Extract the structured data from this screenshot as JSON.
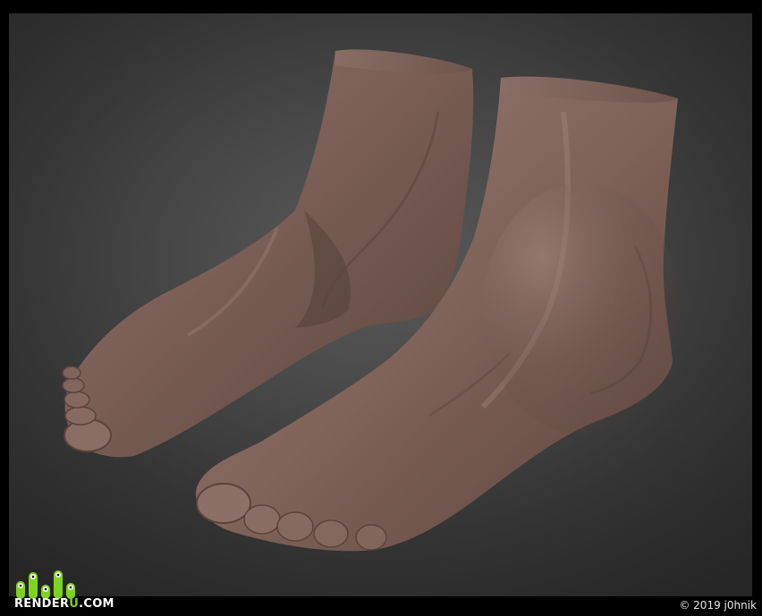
{
  "image": {
    "subject": "3D sculpted pair of human feet"
  },
  "watermark": {
    "brand_prefix": "RENDER",
    "brand_accent": "U",
    "brand_suffix": ".COM",
    "accent_color": "#7ed321"
  },
  "credit": {
    "copyright": "© 2019 j0hnik"
  },
  "colors": {
    "background_center": "#5a5a5a",
    "background_edge": "#262626",
    "skin_base": "#7a5f57",
    "skin_highlight": "#9c7f76",
    "skin_shadow": "#4a3731"
  }
}
